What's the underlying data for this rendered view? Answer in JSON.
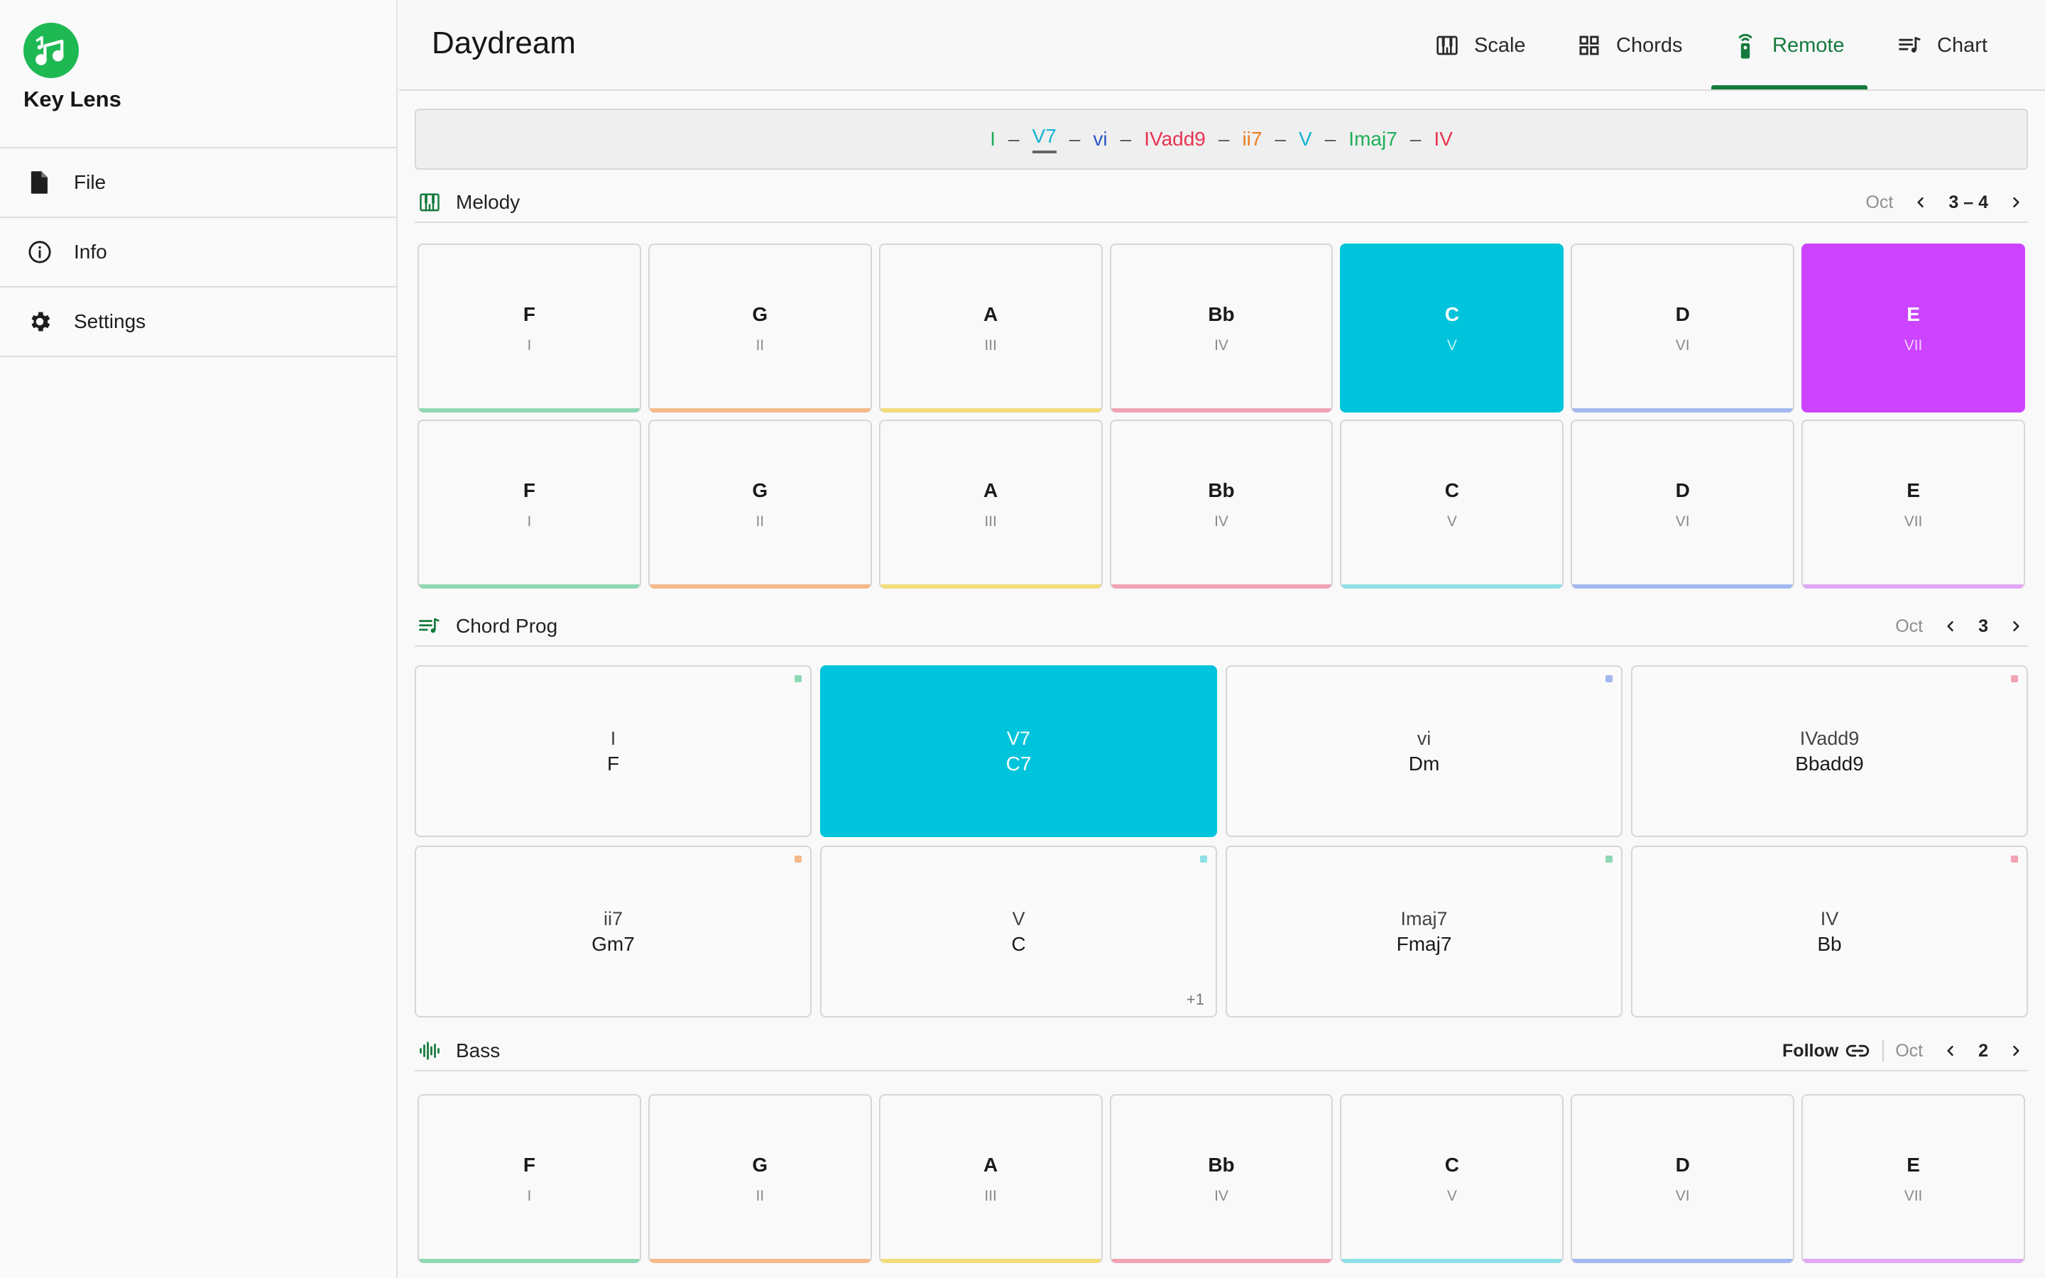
{
  "app": {
    "name": "Key Lens"
  },
  "sidebar": {
    "items": [
      {
        "label": "File",
        "icon": "file-icon"
      },
      {
        "label": "Info",
        "icon": "info-icon"
      },
      {
        "label": "Settings",
        "icon": "gear-icon"
      }
    ]
  },
  "header": {
    "title": "Daydream",
    "tabs": [
      {
        "label": "Scale",
        "icon": "piano-icon"
      },
      {
        "label": "Chords",
        "icon": "grid-icon"
      },
      {
        "label": "Remote",
        "icon": "remote-icon",
        "active": true
      },
      {
        "label": "Chart",
        "icon": "chart-list-icon"
      }
    ]
  },
  "colors": {
    "accent_green": "#157a3d",
    "logo_green": "#1fb954",
    "highlight_cyan": "#00c4dc",
    "highlight_magenta": "#cc44ff",
    "degree_colors": [
      "#8fd8b4",
      "#f5b98a",
      "#f2dd7a",
      "#f1a3b3",
      "#8fe0e6",
      "#a3b8ef",
      "#e1a8f5"
    ]
  },
  "progression": [
    {
      "label": "I",
      "color": "#1fae5a"
    },
    {
      "label": "V7",
      "color": "#13b3d4",
      "current": true
    },
    {
      "label": "vi",
      "color": "#2a56c6"
    },
    {
      "label": "IVadd9",
      "color": "#e8334f"
    },
    {
      "label": "ii7",
      "color": "#e97d1c"
    },
    {
      "label": "V",
      "color": "#13b3d4"
    },
    {
      "label": "Imaj7",
      "color": "#1fae5a"
    },
    {
      "label": "IV",
      "color": "#e8334f"
    }
  ],
  "melody": {
    "title": "Melody",
    "oct_label": "Oct",
    "oct_value": "3 – 4",
    "rows": [
      [
        {
          "note": "F",
          "degree": "I"
        },
        {
          "note": "G",
          "degree": "II"
        },
        {
          "note": "A",
          "degree": "III"
        },
        {
          "note": "Bb",
          "degree": "IV"
        },
        {
          "note": "C",
          "degree": "V",
          "highlight": "#00c4dc"
        },
        {
          "note": "D",
          "degree": "VI"
        },
        {
          "note": "E",
          "degree": "VII",
          "highlight": "#cc44ff"
        }
      ],
      [
        {
          "note": "F",
          "degree": "I"
        },
        {
          "note": "G",
          "degree": "II"
        },
        {
          "note": "A",
          "degree": "III"
        },
        {
          "note": "Bb",
          "degree": "IV"
        },
        {
          "note": "C",
          "degree": "V"
        },
        {
          "note": "D",
          "degree": "VI"
        },
        {
          "note": "E",
          "degree": "VII"
        }
      ]
    ]
  },
  "chord_prog": {
    "title": "Chord Prog",
    "oct_label": "Oct",
    "oct_value": "3",
    "chords": [
      {
        "roman": "I",
        "name": "F",
        "dot": "#8fd8b4"
      },
      {
        "roman": "V7",
        "name": "C7",
        "highlight": "#00c4dc"
      },
      {
        "roman": "vi",
        "name": "Dm",
        "dot": "#a3b8ef"
      },
      {
        "roman": "IVadd9",
        "name": "Bbadd9",
        "dot": "#f1a3b3"
      },
      {
        "roman": "ii7",
        "name": "Gm7",
        "dot": "#f5b98a"
      },
      {
        "roman": "V",
        "name": "C",
        "dot": "#8fe0e6",
        "extra": "+1"
      },
      {
        "roman": "Imaj7",
        "name": "Fmaj7",
        "dot": "#8fd8b4"
      },
      {
        "roman": "IV",
        "name": "Bb",
        "dot": "#f1a3b3"
      }
    ]
  },
  "bass": {
    "title": "Bass",
    "follow_label": "Follow",
    "oct_label": "Oct",
    "oct_value": "2",
    "notes": [
      {
        "note": "F",
        "degree": "I"
      },
      {
        "note": "G",
        "degree": "II"
      },
      {
        "note": "A",
        "degree": "III"
      },
      {
        "note": "Bb",
        "degree": "IV"
      },
      {
        "note": "C",
        "degree": "V"
      },
      {
        "note": "D",
        "degree": "VI"
      },
      {
        "note": "E",
        "degree": "VII"
      }
    ]
  }
}
